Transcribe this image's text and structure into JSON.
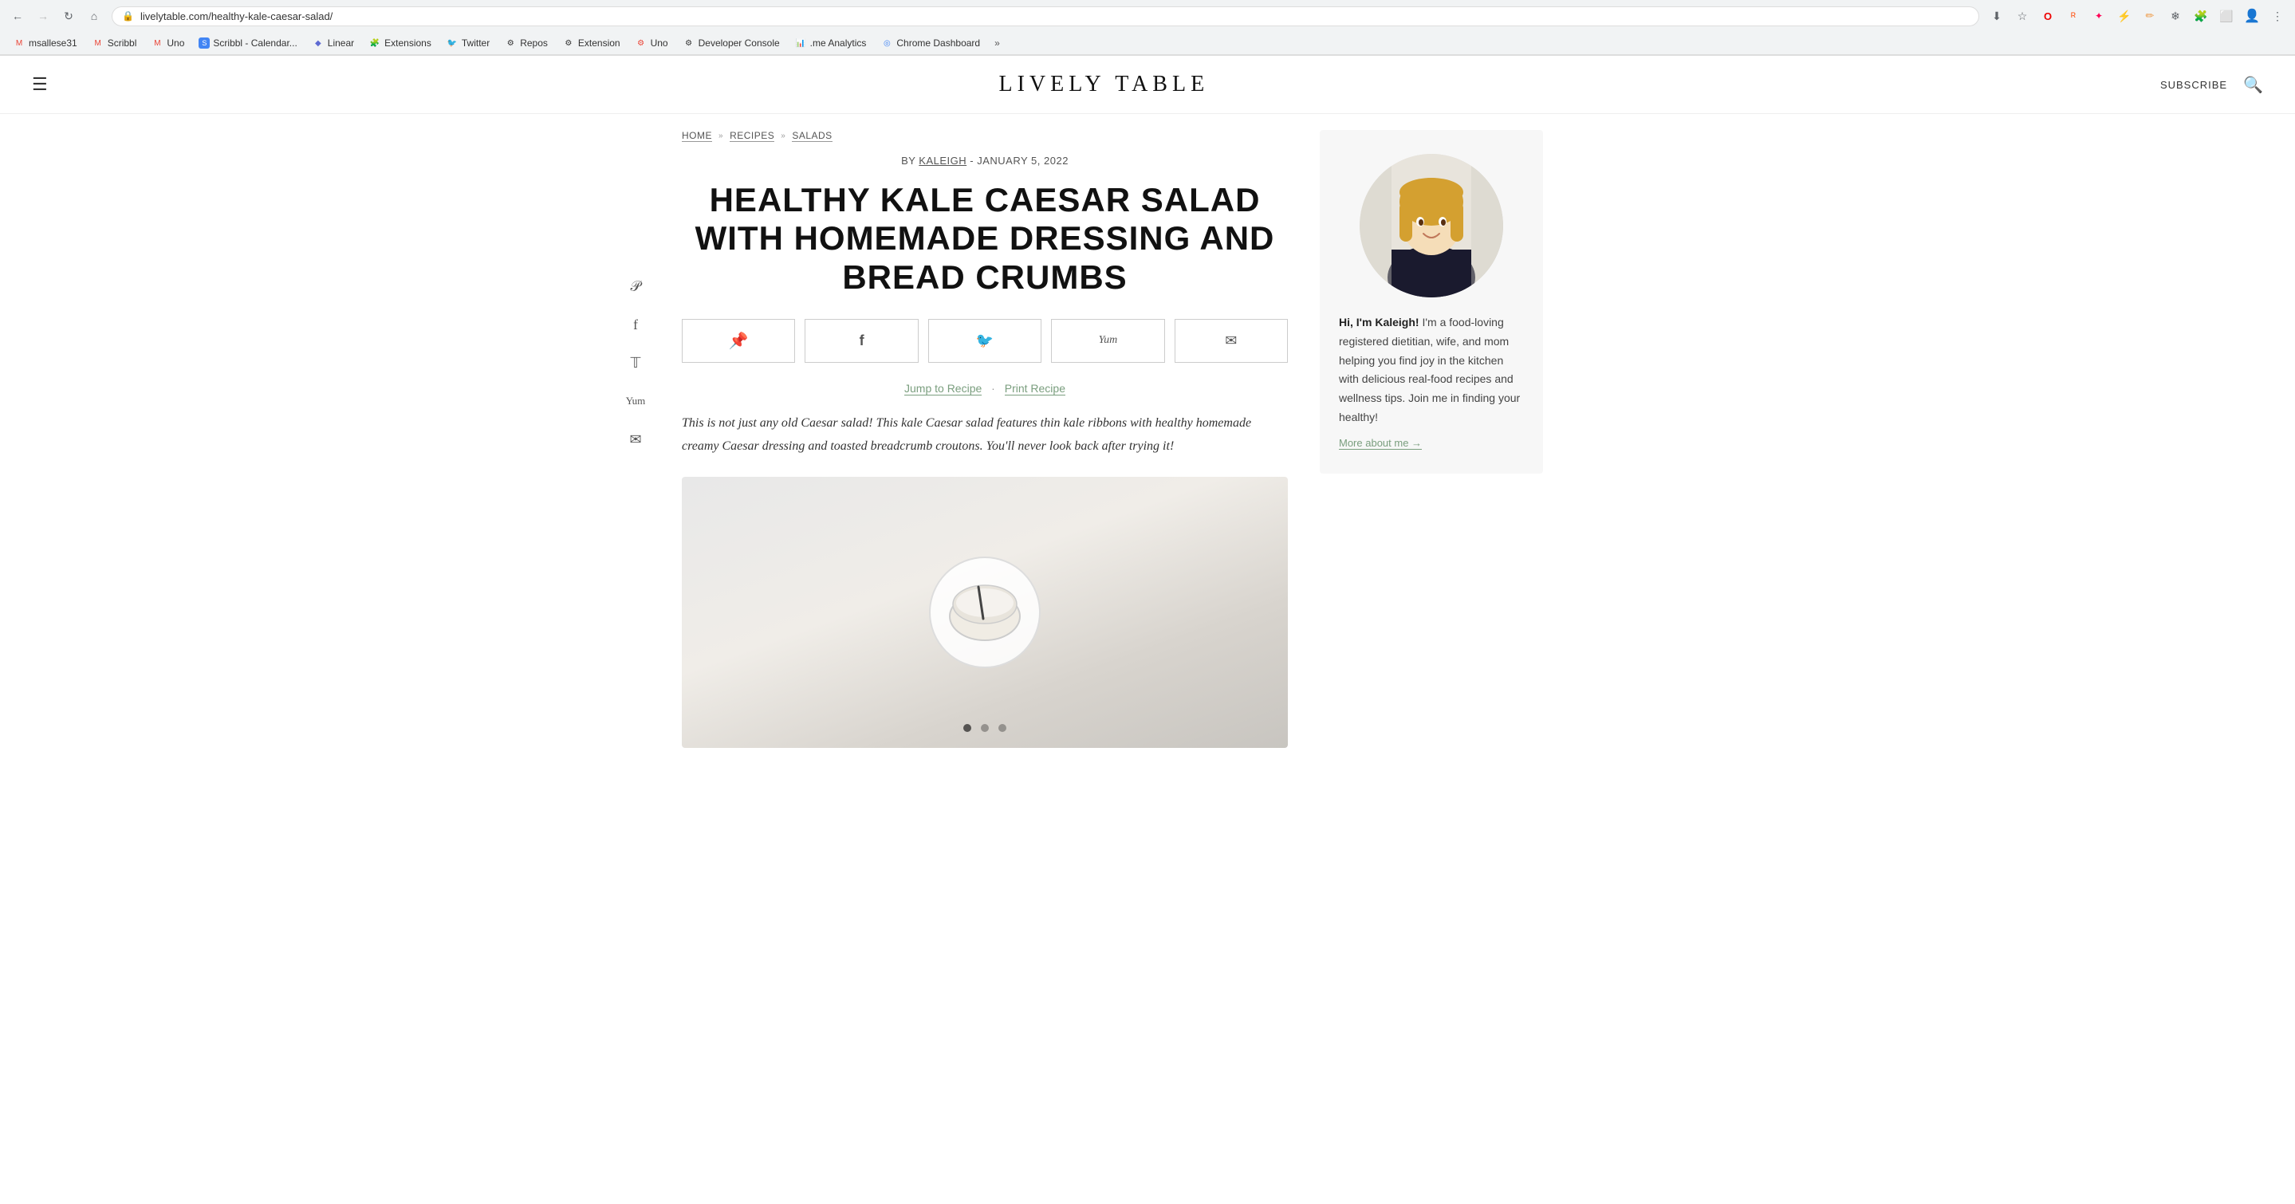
{
  "browser": {
    "url": "livelytable.com/healthy-kale-caesar-salad/",
    "back_disabled": false,
    "forward_disabled": true,
    "bookmarks": [
      {
        "label": "msallese31",
        "icon": "gmail",
        "color": "#ea4335"
      },
      {
        "label": "Scribbl",
        "icon": "gmail",
        "color": "#ea4335"
      },
      {
        "label": "Uno",
        "icon": "gmail",
        "color": "#ea4335"
      },
      {
        "label": "Scribbl - Calendar...",
        "icon": "scribbl",
        "color": "#4285f4"
      },
      {
        "label": "Linear",
        "icon": "linear",
        "color": "#5e6ad2"
      },
      {
        "label": "Extensions",
        "icon": "ext",
        "color": "#4285f4"
      },
      {
        "label": "Twitter",
        "icon": "twitter",
        "color": "#1da1f2"
      },
      {
        "label": "Repos",
        "icon": "github",
        "color": "#333"
      },
      {
        "label": "Extension",
        "icon": "github",
        "color": "#333"
      },
      {
        "label": "Uno",
        "icon": "uno",
        "color": "#ea4335"
      },
      {
        "label": "Developer Console",
        "icon": "dev",
        "color": "#333"
      },
      {
        "label": ".me Analytics",
        "icon": "analytics",
        "color": "#e94c3d"
      },
      {
        "label": "Chrome Dashboard",
        "icon": "chrome",
        "color": "#4285f4"
      },
      {
        "label": "more",
        "icon": "more",
        "color": "#555"
      }
    ]
  },
  "header": {
    "logo": "LIVELY TABLE",
    "subscribe_label": "SUBSCRIBE",
    "menu_label": "☰"
  },
  "breadcrumb": {
    "home": "HOME",
    "recipes": "RECIPES",
    "salads": "SALADS"
  },
  "article": {
    "author": "KALEIGH",
    "by_prefix": "BY",
    "date": "JANUARY 5, 2022",
    "title": "HEALTHY KALE CAESAR SALAD WITH HOMEMADE DRESSING AND BREAD CRUMBS",
    "jump_recipe": "Jump to Recipe",
    "print_recipe": "Print Recipe",
    "description": "This is not just any old Caesar salad! This kale Caesar salad features thin kale ribbons with healthy homemade creamy Caesar dressing and toasted breadcrumb croutons. You'll never look back after trying it!"
  },
  "share_buttons": [
    {
      "icon": "pinterest",
      "symbol": "📌"
    },
    {
      "icon": "facebook",
      "symbol": "f"
    },
    {
      "icon": "twitter",
      "symbol": "🐦"
    },
    {
      "icon": "yummly",
      "symbol": "𝕐"
    },
    {
      "icon": "email",
      "symbol": "✉"
    }
  ],
  "social_sidebar": [
    {
      "icon": "pinterest",
      "symbol": "𝒫"
    },
    {
      "icon": "facebook",
      "symbol": "f"
    },
    {
      "icon": "twitter",
      "symbol": "𝕋"
    },
    {
      "icon": "yummly",
      "symbol": "𝕐"
    },
    {
      "icon": "email",
      "symbol": "✉"
    }
  ],
  "sidebar": {
    "author_greeting": "Hi, I'm Kaleigh!",
    "author_bio": " I'm a food-loving registered dietitian, wife, and mom helping you find joy in the kitchen with delicious real-food recipes and wellness tips. Join me in finding your healthy!",
    "more_link": "More about me →"
  }
}
